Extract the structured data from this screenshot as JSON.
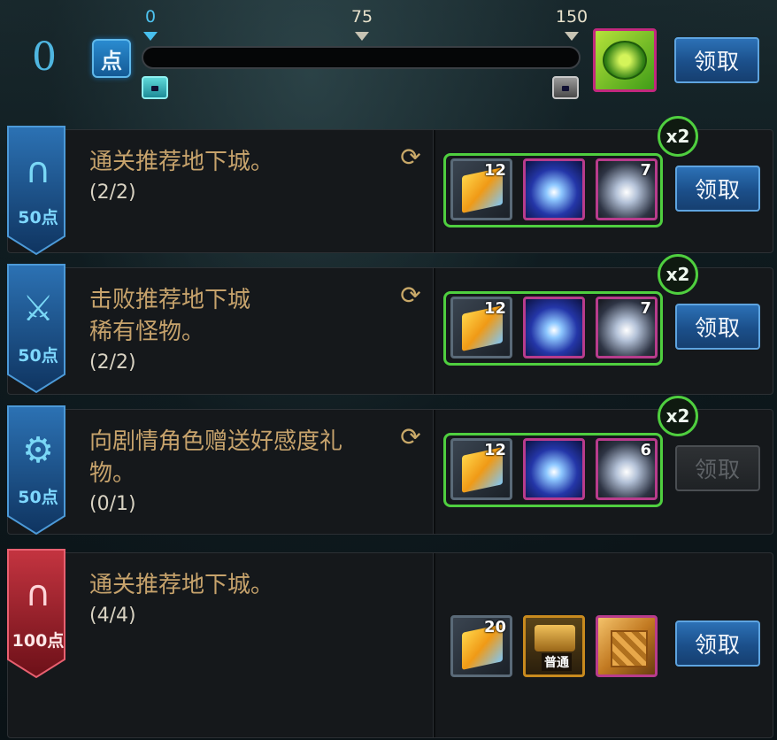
{
  "header": {
    "score": "0",
    "point_icon_label": "点",
    "progress_fraction": 0,
    "ticks": [
      "0",
      "75",
      "150"
    ],
    "claim_label": "领取"
  },
  "tasks": [
    {
      "points": "50点",
      "badge_icon": "gate-icon",
      "desc_lines": [
        "通关推荐地下城。"
      ],
      "progress": "(2/2)",
      "multiplier": "x2",
      "rewards": [
        {
          "kind": "gold-ticket",
          "count": "12"
        },
        {
          "kind": "blue-orb",
          "count": ""
        },
        {
          "kind": "cloud-orb",
          "count": "7"
        }
      ],
      "claim_label": "领取",
      "claim_enabled": true
    },
    {
      "points": "50点",
      "badge_icon": "sword-icon",
      "desc_lines": [
        "击败推荐地下城",
        "稀有怪物。"
      ],
      "progress": "(2/2)",
      "multiplier": "x2",
      "rewards": [
        {
          "kind": "gold-ticket",
          "count": "12"
        },
        {
          "kind": "blue-orb",
          "count": ""
        },
        {
          "kind": "cloud-orb",
          "count": "7"
        }
      ],
      "claim_label": "领取",
      "claim_enabled": true
    },
    {
      "points": "50点",
      "badge_icon": "gear-icon",
      "desc_lines": [
        "向剧情角色赠送好感度礼",
        "物。"
      ],
      "progress": "(0/1)",
      "multiplier": "x2",
      "rewards": [
        {
          "kind": "gold-ticket",
          "count": "12"
        },
        {
          "kind": "blue-orb",
          "count": ""
        },
        {
          "kind": "cloud-orb",
          "count": "6"
        }
      ],
      "claim_label": "领取",
      "claim_enabled": false
    },
    {
      "points": "100点",
      "badge_icon": "gate-icon",
      "desc_lines": [
        "通关推荐地下城。"
      ],
      "progress": "(4/4)",
      "multiplier": "",
      "rewards": [
        {
          "kind": "gold-ticket",
          "count": "20"
        },
        {
          "kind": "chest",
          "count": "",
          "tag": "普通"
        },
        {
          "kind": "cube",
          "count": ""
        }
      ],
      "claim_label": "领取",
      "claim_enabled": true
    }
  ],
  "colors": {
    "accent": "#3fb0e0",
    "green": "#4fcf3f",
    "gold_text": "#c7a36c"
  }
}
